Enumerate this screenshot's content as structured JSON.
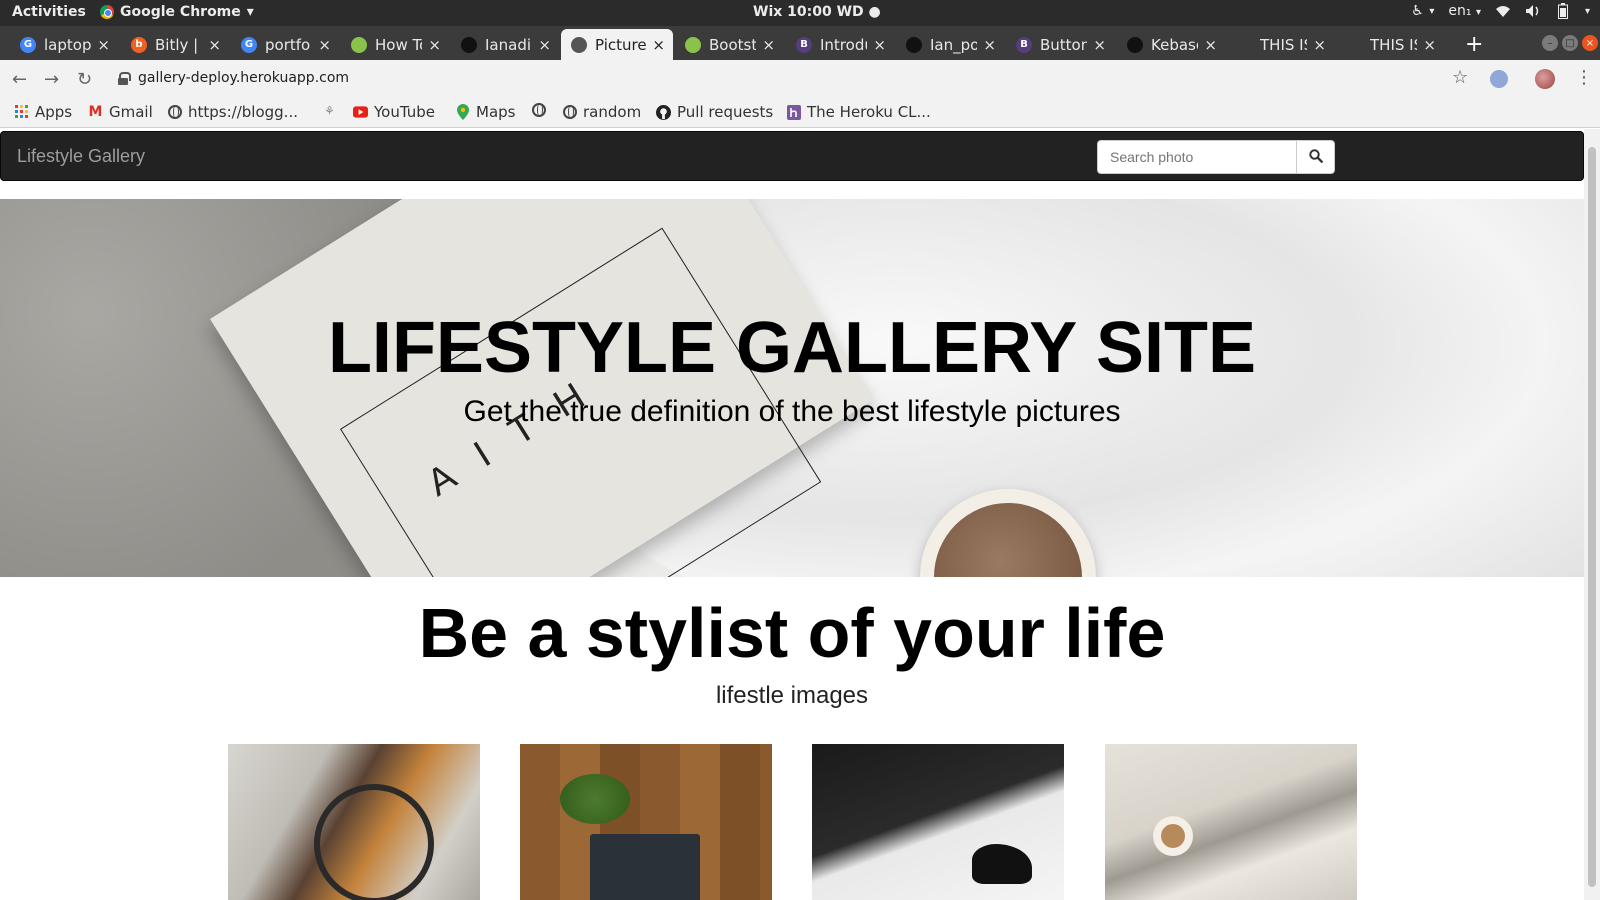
{
  "gnome": {
    "activities": "Activities",
    "app_name": "Google Chrome",
    "clock": "Wix 10:00 WD",
    "lang": "en₁"
  },
  "tabs": [
    {
      "title": "laptop",
      "fav": "G",
      "fav_color": "#4285f4"
    },
    {
      "title": "Bitly | C",
      "fav": "b",
      "fav_color": "#ee6123"
    },
    {
      "title": "portfo",
      "fav": "G",
      "fav_color": "#4285f4"
    },
    {
      "title": "How To",
      "fav": "",
      "fav_color": "#8bc34a"
    },
    {
      "title": "Ianadil",
      "fav": "",
      "fav_color": "#111111"
    },
    {
      "title": "Picture",
      "fav": "",
      "fav_color": "#555555"
    },
    {
      "title": "Bootst",
      "fav": "",
      "fav_color": "#8bc34a"
    },
    {
      "title": "Introdu",
      "fav": "B",
      "fav_color": "#563d7c"
    },
    {
      "title": "Ian_po",
      "fav": "",
      "fav_color": "#111111"
    },
    {
      "title": "Button",
      "fav": "B",
      "fav_color": "#563d7c"
    },
    {
      "title": "Kebaso",
      "fav": "",
      "fav_color": "#111111"
    },
    {
      "title": "THIS IS",
      "fav": "",
      "fav_color": "#3b3b3b"
    },
    {
      "title": "THIS IS",
      "fav": "",
      "fav_color": "#3b3b3b"
    }
  ],
  "toolbar": {
    "url": "gallery-deploy.herokuapp.com"
  },
  "bookmarks": [
    {
      "label": "Apps",
      "icon": "apps-grid-icon"
    },
    {
      "label": "Gmail",
      "icon": "gmail-icon"
    },
    {
      "label": "https://blogg...",
      "icon": "globe-icon"
    },
    {
      "label": "",
      "icon": "palm-icon"
    },
    {
      "label": "YouTube",
      "icon": "youtube-icon"
    },
    {
      "label": "Maps",
      "icon": "maps-pin-icon"
    },
    {
      "label": "",
      "icon": "globe-icon"
    },
    {
      "label": "random",
      "icon": "globe-icon"
    },
    {
      "label": "Pull requests",
      "icon": "github-icon"
    },
    {
      "label": "The Heroku CL...",
      "icon": "heroku-icon"
    }
  ],
  "site": {
    "brand": "Lifestyle Gallery",
    "search_placeholder": "Search photo",
    "hero_title": "LIFESTYLE GALLERY SITE",
    "hero_subtitle": "Get the true definition of the best lifestyle pictures",
    "section_title": "Be a stylist of your life",
    "section_subtitle": "lifestle images",
    "hero_book_text": "AITH"
  },
  "colors": {
    "navbar_bg": "#222222",
    "brand_text": "#9d9d9d",
    "gnome_bar": "#2b2b2b",
    "tabstrip": "#3b3b3b"
  }
}
